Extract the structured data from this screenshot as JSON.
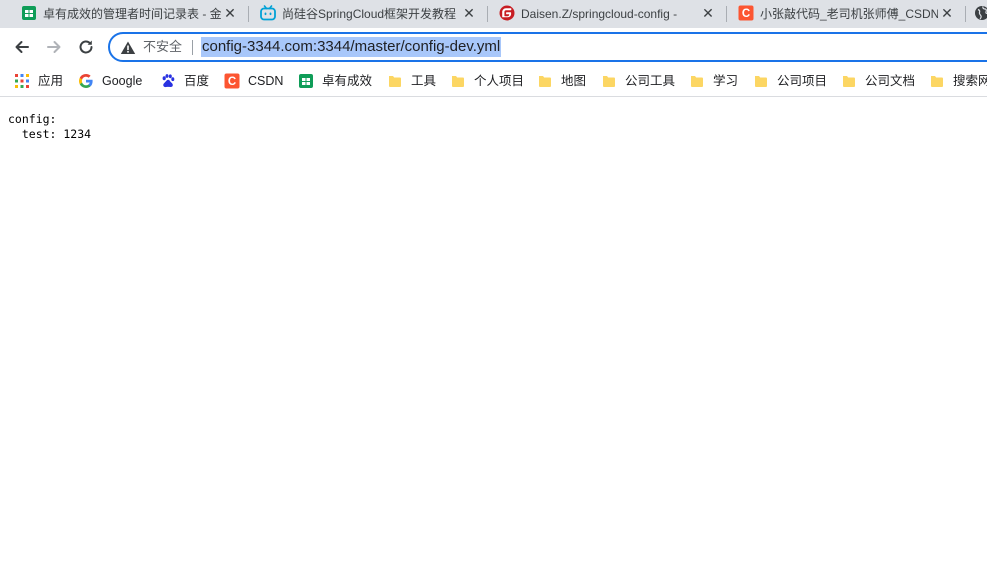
{
  "browser": {
    "tabs": [
      {
        "title": "卓有成效的管理者时间记录表 - 金",
        "favicon": "sheets-icon",
        "active": false
      },
      {
        "title": "尚硅谷SpringCloud框架开发教程",
        "favicon": "bilibili-icon",
        "active": false
      },
      {
        "title": "Daisen.Z/springcloud-config -",
        "favicon": "gitee-icon",
        "active": false
      },
      {
        "title": "小张敲代码_老司机张师傅_CSDN",
        "favicon": "csdn-icon",
        "active": false
      }
    ],
    "close_glyph": "✕",
    "address_bar": {
      "security_label": "不安全",
      "url": "config-3344.com:3344/master/config-dev.yml"
    },
    "bookmarks": [
      {
        "label": "应用",
        "icon": "apps-grid-icon"
      },
      {
        "label": "Google",
        "icon": "google-icon"
      },
      {
        "label": "百度",
        "icon": "baidu-paw-icon"
      },
      {
        "label": "CSDN",
        "icon": "csdn-icon"
      },
      {
        "label": "卓有成效",
        "icon": "sheets-icon"
      },
      {
        "label": "工具",
        "icon": "folder-icon"
      },
      {
        "label": "个人项目",
        "icon": "folder-icon"
      },
      {
        "label": "地图",
        "icon": "folder-icon"
      },
      {
        "label": "公司工具",
        "icon": "folder-icon"
      },
      {
        "label": "学习",
        "icon": "folder-icon"
      },
      {
        "label": "公司项目",
        "icon": "folder-icon"
      },
      {
        "label": "公司文档",
        "icon": "folder-icon"
      },
      {
        "label": "搜索网",
        "icon": "folder-icon"
      }
    ],
    "colors": {
      "tabstrip": "#dee1e6",
      "focus_ring": "#1a73e8",
      "url_selection": "#a8c7fa",
      "folder": "#fcd663",
      "csdn": "#fc5531",
      "gitee": "#c71d23",
      "bilibili": "#00a1d6",
      "sheets": "#0f9d58"
    }
  },
  "page": {
    "lines": [
      "config:",
      "  test: 1234"
    ]
  }
}
